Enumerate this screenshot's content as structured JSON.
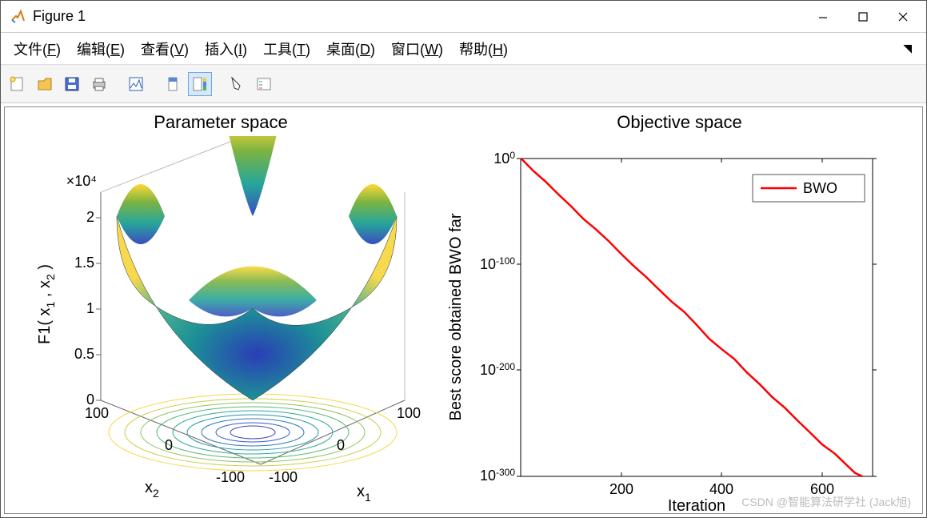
{
  "window": {
    "title": "Figure 1",
    "minimize_tooltip": "Minimize",
    "maximize_tooltip": "Maximize",
    "close_tooltip": "Close"
  },
  "menu": {
    "file": "文件(F)",
    "edit": "编辑(E)",
    "view": "查看(V)",
    "insert": "插入(I)",
    "tools": "工具(T)",
    "desktop": "桌面(D)",
    "window": "窗口(W)",
    "help": "帮助(H)",
    "dock": "⇱"
  },
  "toolbar": {
    "new": "new-figure",
    "open": "open",
    "save": "save",
    "print": "print",
    "link": "link-plot",
    "brush": "brush",
    "insert_colorbar": "insert-colorbar",
    "cursor": "edit-plot",
    "insert_legend": "insert-legend"
  },
  "chart_data": [
    {
      "type": "surface3d",
      "title": "Parameter space",
      "xlabel": "x₁",
      "ylabel": "x₂",
      "zlabel": "F1( x₁ , x₂ )",
      "z_scale_label": "×10⁴",
      "x_ticks": [
        -100,
        0,
        100
      ],
      "y_ticks": [
        -100,
        0,
        100
      ],
      "z_ticks": [
        0,
        0.5,
        1,
        1.5,
        2
      ],
      "xlim": [
        -100,
        100
      ],
      "ylim": [
        -100,
        100
      ],
      "zlim": [
        0,
        2
      ],
      "function_description": "sum of squares / Sphere-like benchmark",
      "has_contour_floor": true
    },
    {
      "type": "line",
      "title": "Objective space",
      "xlabel": "Iteration",
      "ylabel": "Best score obtained BWO far",
      "yscale": "log",
      "xlim": [
        0,
        700
      ],
      "ylim": [
        1e-300,
        1
      ],
      "x_ticks": [
        200,
        400,
        600
      ],
      "y_ticks_exp": [
        0,
        -100,
        -200,
        -300
      ],
      "legend": {
        "position": "northeast"
      },
      "series": [
        {
          "name": "BWO",
          "color": "#ff0000",
          "line_width": 2,
          "data_approx": [
            {
              "iter": 1,
              "log10_best": 0
            },
            {
              "iter": 50,
              "log10_best": -22
            },
            {
              "iter": 100,
              "log10_best": -45
            },
            {
              "iter": 150,
              "log10_best": -67
            },
            {
              "iter": 200,
              "log10_best": -90
            },
            {
              "iter": 250,
              "log10_best": -112
            },
            {
              "iter": 300,
              "log10_best": -135
            },
            {
              "iter": 350,
              "log10_best": -157
            },
            {
              "iter": 400,
              "log10_best": -180
            },
            {
              "iter": 450,
              "log10_best": -202
            },
            {
              "iter": 500,
              "log10_best": -225
            },
            {
              "iter": 550,
              "log10_best": -247
            },
            {
              "iter": 600,
              "log10_best": -270
            },
            {
              "iter": 650,
              "log10_best": -290
            },
            {
              "iter": 680,
              "log10_best": -300
            }
          ]
        }
      ]
    }
  ],
  "watermark": "CSDN @智能算法研学社 (Jack旭)"
}
